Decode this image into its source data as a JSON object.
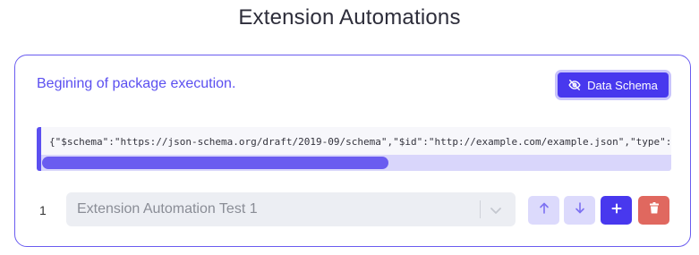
{
  "page": {
    "title": "Extension Automations"
  },
  "card": {
    "heading": "Begining of package execution.",
    "schema_button_label": "Data Schema",
    "schema_button_icon": "eye-off-icon",
    "code": "{\"$schema\":\"https://json-schema.org/draft/2019-09/schema\",\"$id\":\"http://example.com/example.json\",\"type\":\"object\",\"default\":{},\"title\":\"Root Schema\"}",
    "code_scroll_fraction": 0.55
  },
  "rows": [
    {
      "index": "1",
      "selected_automation": "Extension Automation Test 1",
      "actions": {
        "move_up_icon": "arrow-up-icon",
        "move_down_icon": "arrow-down-icon",
        "add_icon": "plus-icon",
        "delete_icon": "trash-icon"
      }
    }
  ],
  "colors": {
    "accent": "#4838ee",
    "accent_light": "#dcdafc",
    "danger": "#e0685f",
    "heading_text": "#5b4ff0"
  }
}
